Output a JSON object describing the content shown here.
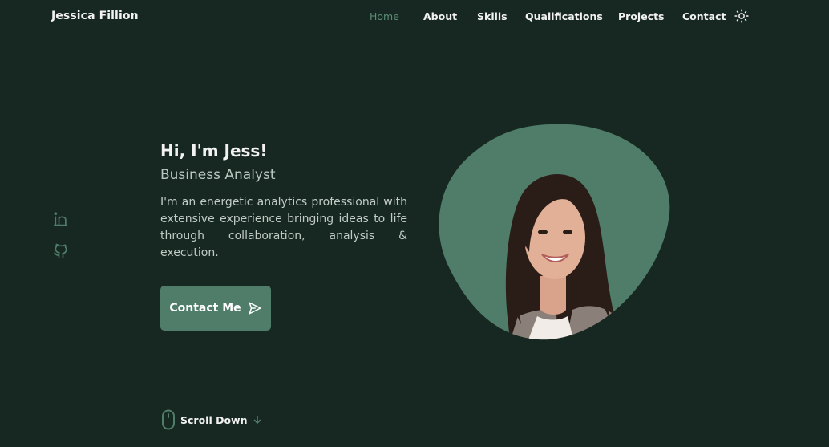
{
  "header": {
    "logo": "Jessica Fillion",
    "nav": [
      {
        "label": "Home",
        "active": true
      },
      {
        "label": "About",
        "active": false
      },
      {
        "label": "Skills",
        "active": false
      },
      {
        "label": "Qualifications",
        "active": false
      },
      {
        "label": "Projects",
        "active": false
      },
      {
        "label": "Contact",
        "active": false
      }
    ],
    "theme_icon": "sun-icon"
  },
  "social": [
    {
      "icon": "linkedin-icon"
    },
    {
      "icon": "github-icon"
    }
  ],
  "hero": {
    "title": "Hi, I'm Jess!",
    "subtitle": "Business Analyst",
    "description": "I'm an energetic analytics professional with extensive experience bringing ideas to life through collaboration, analysis & execution.",
    "button_label": "Contact Me",
    "button_icon": "send-icon"
  },
  "scroll": {
    "label": "Scroll Down",
    "icons": [
      "mouse-icon",
      "arrow-down-icon"
    ]
  },
  "colors": {
    "background": "#172721",
    "accent": "#4f7d6a",
    "text": "#f2f2f2",
    "muted": "#c2ccc7"
  }
}
